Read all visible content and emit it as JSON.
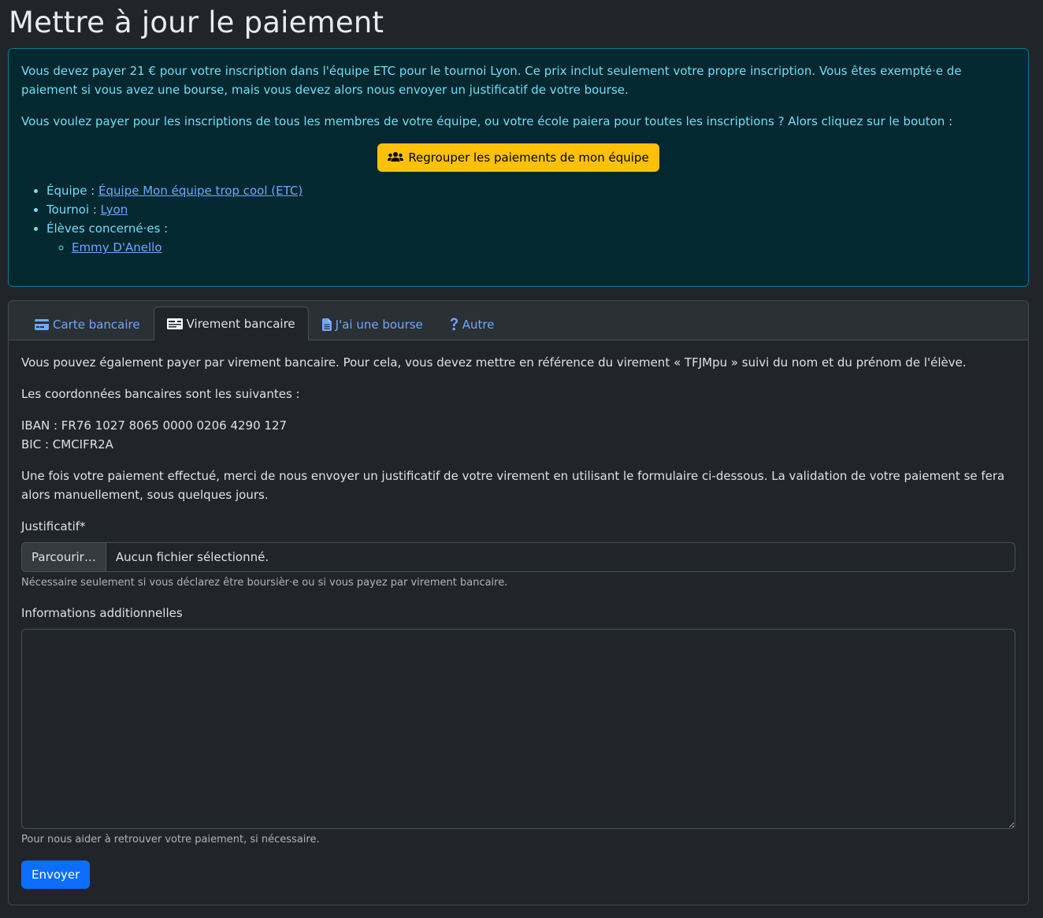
{
  "page": {
    "title": "Mettre à jour le paiement"
  },
  "alert": {
    "paragraph1": "Vous devez payer 21 € pour votre inscription dans l'équipe ETC pour le tournoi Lyon. Ce prix inclut seulement votre propre inscription. Vous êtes exempté·e de paiement si vous avez une bourse, mais vous devez alors nous envoyer un justificatif de votre bourse.",
    "paragraph2": "Vous voulez payer pour les inscriptions de tous les membres de votre équipe, ou votre école paiera pour toutes les inscriptions ? Alors cliquez sur le bouton :",
    "group_button": {
      "label": "Regrouper les paiements de mon équipe",
      "icon": "users-icon"
    },
    "details": {
      "team_label": "Équipe :",
      "team_link": "Équipe Mon équipe trop cool (ETC)",
      "tournament_label": "Tournoi :",
      "tournament_link": "Lyon",
      "students_label": "Élèves concerné·es :",
      "students": [
        "Emmy D'Anello"
      ]
    }
  },
  "tabs": [
    {
      "label": "Carte bancaire",
      "icon": "credit-card-icon",
      "active": false
    },
    {
      "label": "Virement bancaire",
      "icon": "money-check-icon",
      "active": true
    },
    {
      "label": "J'ai une bourse",
      "icon": "file-icon",
      "active": false
    },
    {
      "label": "Autre",
      "icon": "question-icon",
      "active": false
    }
  ],
  "transfer": {
    "intro": "Vous pouvez également payer par virement bancaire. Pour cela, vous devez mettre en référence du virement « TFJMpu » suivi du nom et du prénom de l'élève.",
    "coords_intro": "Les coordonnées bancaires sont les suivantes :",
    "iban": "IBAN : FR76 1027 8065 0000 0206 4290 127",
    "bic": "BIC : CMCIFR2A",
    "after_payment": "Une fois votre paiement effectué, merci de nous envoyer un justificatif de votre virement en utilisant le formulaire ci-dessous. La validation de votre paiement se fera alors manuellement, sous quelques jours."
  },
  "form": {
    "receipt_label": "Justificatif*",
    "file_button": "Parcourir…",
    "file_status": "Aucun fichier sélectionné.",
    "receipt_help": "Nécessaire seulement si vous déclarez être boursièr·e ou si vous payez par virement bancaire.",
    "info_label": "Informations additionnelles",
    "info_value": "",
    "info_help": "Pour nous aider à retrouver votre paiement, si nécessaire.",
    "submit_label": "Envoyer"
  },
  "colors": {
    "background": "#212529",
    "alert_bg": "#032830",
    "alert_text": "#6edff6",
    "link": "#6ea8fe",
    "warning": "#ffc107",
    "primary": "#0d6efd"
  }
}
